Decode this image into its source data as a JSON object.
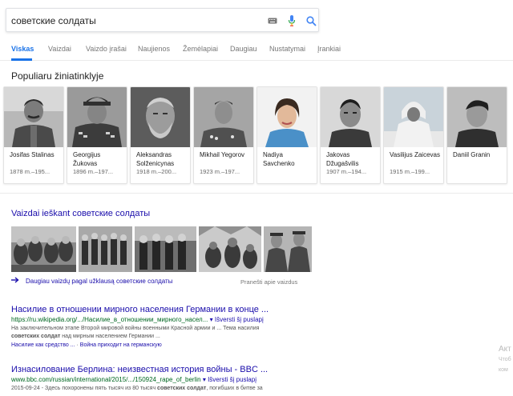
{
  "search": {
    "query": "советские солдаты",
    "keyboard_icon": "keyboard-icon",
    "mic_icon": "microphone-icon",
    "search_icon": "search-icon"
  },
  "tabs": [
    {
      "label": "Viskas",
      "active": true
    },
    {
      "label": "Vaizdai"
    },
    {
      "label": "Vaizdo įrašai"
    },
    {
      "label": "Naujienos"
    },
    {
      "label": "Žemėlapiai"
    },
    {
      "label": "Daugiau"
    },
    {
      "label": "Nustatymai"
    },
    {
      "label": "Įrankiai"
    }
  ],
  "popular": {
    "title": "Populiaru žiniatinklyje",
    "people": [
      {
        "name": "Josifas Stalinas",
        "years": "1878 m.–195..."
      },
      {
        "name": "Georgijus Žukovas",
        "years": "1896 m.–197..."
      },
      {
        "name": "Aleksandras Solženicynas",
        "years": "1918 m.–200..."
      },
      {
        "name": "Mikhail Yegorov",
        "years": "1923 m.–197..."
      },
      {
        "name": "Nadiya Savchenko",
        "years": ""
      },
      {
        "name": "Jakovas Džugašvilis",
        "years": "1907 m.–194..."
      },
      {
        "name": "Vasilijus Zaicevas",
        "years": "1915 m.–199..."
      },
      {
        "name": "Daniil Granin",
        "years": ""
      }
    ]
  },
  "images": {
    "title": "Vaizdai ieškant советские солдаты",
    "more_label": "Daugiau vaizdų pagal užklausą советские солдаты",
    "report_label": "Pranešti apie vaizdus"
  },
  "results": [
    {
      "title": "Насилие в отношении мирного населения Германии в конце ...",
      "url": "https://ru.wikipedia.org/.../Насилие_в_отношении_мирного_насел...",
      "translate": "▾ Išversti šį puslapį",
      "snippet_1": "На заключительном этапе Второй мировой войны военными Красной армии и ... Тема насилия",
      "snippet_2a": "советских солдат",
      "snippet_2b": " над мирным населением Германии ...",
      "link_1": "Насилие как средство ...",
      "link_sep": " · ",
      "link_2": "Война приходит на германскую"
    },
    {
      "title": "Изнасилование Берлина: неизвестная история войны - BBC ...",
      "url": "www.bbc.com/russian/international/2015/.../150924_rape_of_berlin",
      "translate": "▾ Išversti šį puslapį",
      "snippet_1": "2015-09-24 - Здесь похоронены пять тысяч из 80 тысяч ",
      "snippet_1b": "советских солдат",
      "snippet_1c": ", погибших в битве за"
    }
  ],
  "watermark": {
    "line1": "Акт",
    "line2": "Чтоб",
    "line3": "ком"
  },
  "colors": {
    "link": "#1a0dab",
    "url": "#006621",
    "accent": "#1a73e8"
  }
}
